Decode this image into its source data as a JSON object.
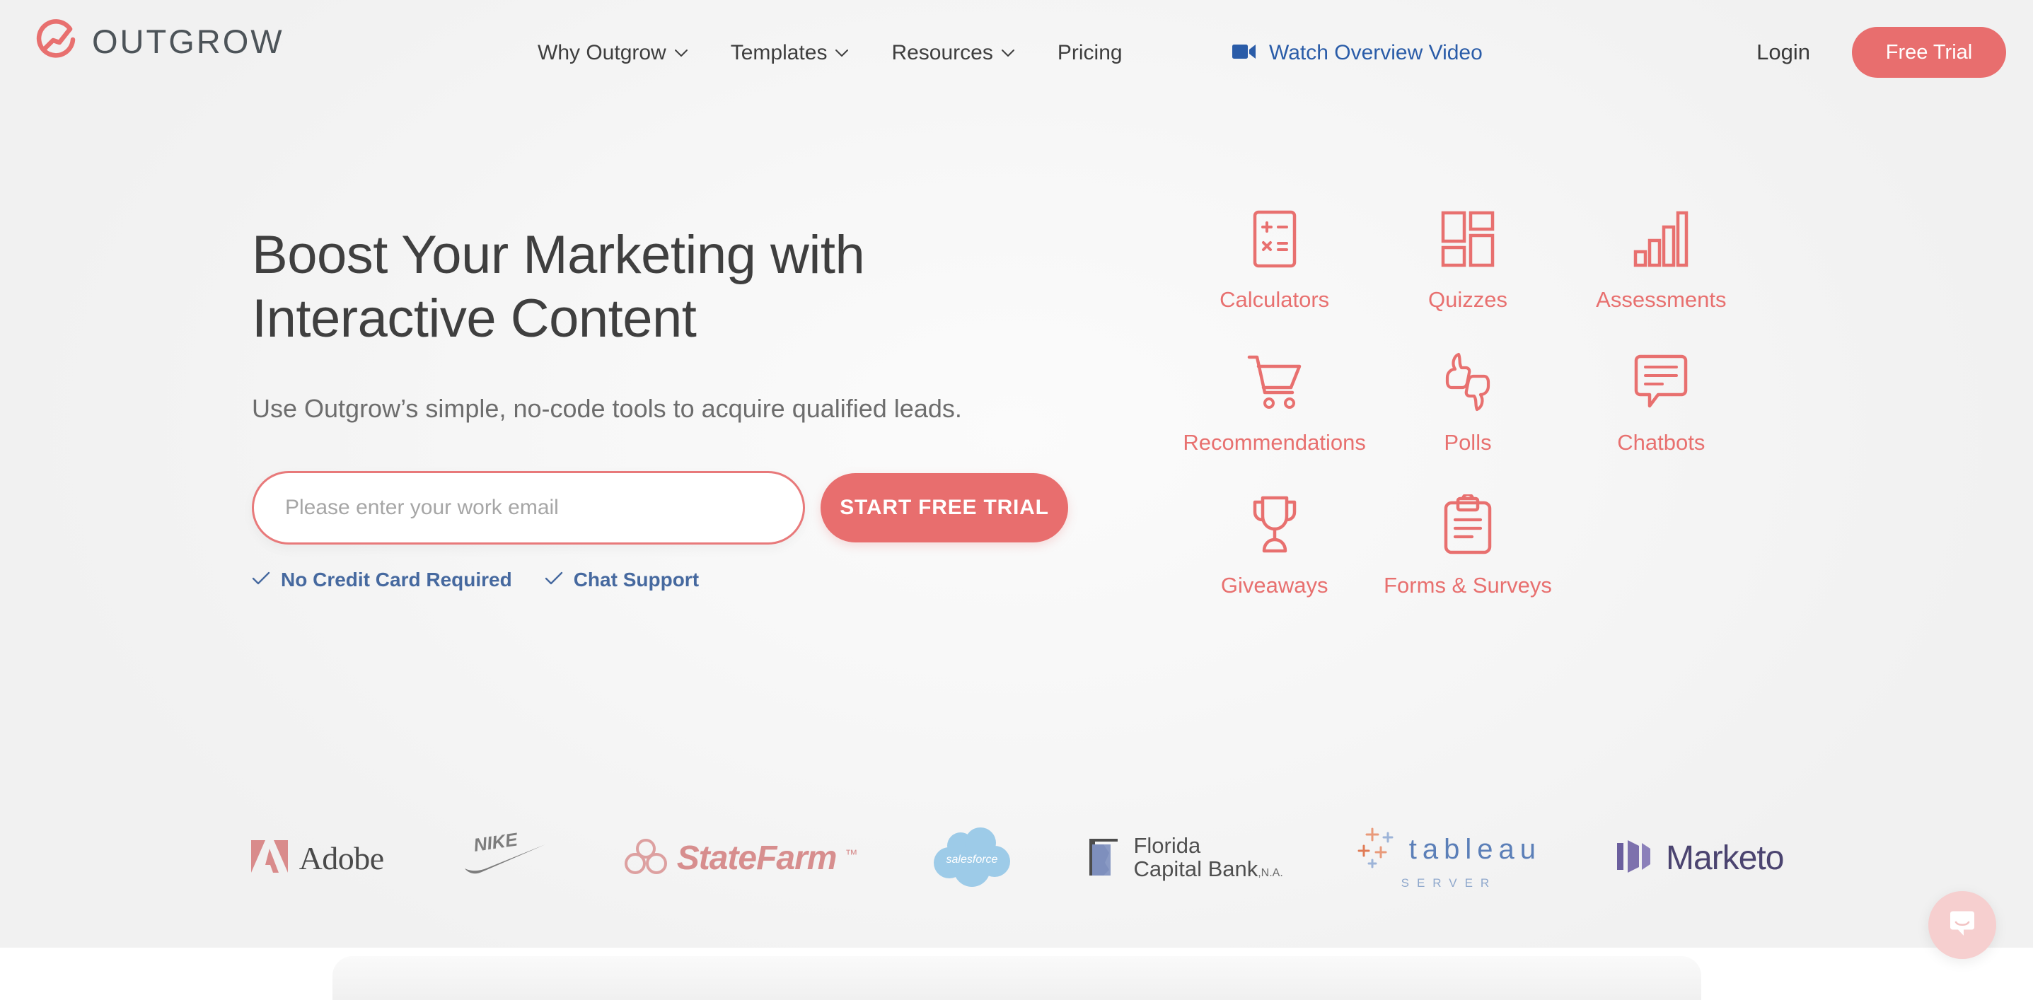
{
  "brand": {
    "name": "OUTGROW",
    "logo_icon": "outgrow-circle-logo",
    "accent_color": "#e86e6e",
    "accent_light": "#e8797a",
    "link_blue": "#2a5ca8",
    "perk_blue": "#46699f",
    "heading_gray": "#3f3f3f"
  },
  "header": {
    "nav": [
      {
        "label": "Why Outgrow",
        "icon": "chevron-down-icon",
        "has_dropdown": true
      },
      {
        "label": "Templates",
        "icon": "chevron-down-icon",
        "has_dropdown": true
      },
      {
        "label": "Resources",
        "icon": "chevron-down-icon",
        "has_dropdown": true
      },
      {
        "label": "Pricing",
        "icon": "",
        "has_dropdown": false
      }
    ],
    "video_link": {
      "label": "Watch Overview Video",
      "icon": "video-camera-icon"
    },
    "login_label": "Login",
    "free_trial_label": "Free Trial"
  },
  "hero": {
    "headline_line1": "Boost Your Marketing with",
    "headline_line2": "Interactive Content",
    "subheadline": "Use Outgrow’s simple, no-code tools to acquire qualified leads.",
    "email_placeholder": "Please enter your work email",
    "email_value": "",
    "cta_label": "START FREE TRIAL",
    "perks": [
      {
        "icon": "check-icon",
        "label": "No Credit Card Required"
      },
      {
        "icon": "check-icon",
        "label": "Chat Support"
      }
    ]
  },
  "product_tiles": [
    {
      "label": "Calculators",
      "icon": "calculator-icon"
    },
    {
      "label": "Quizzes",
      "icon": "quiz-grid-icon"
    },
    {
      "label": "Assessments",
      "icon": "bar-chart-icon"
    },
    {
      "label": "Recommendations",
      "icon": "shopping-cart-icon"
    },
    {
      "label": "Polls",
      "icon": "thumbs-up-down-icon"
    },
    {
      "label": "Chatbots",
      "icon": "chat-bubble-icon"
    },
    {
      "label": "Giveaways",
      "icon": "trophy-icon"
    },
    {
      "label": "Forms & Surveys",
      "icon": "clipboard-icon"
    }
  ],
  "brands": [
    {
      "name": "Adobe",
      "word": "Adobe",
      "icon": "adobe-logo"
    },
    {
      "name": "Nike",
      "word": "",
      "icon": "nike-swoosh-logo"
    },
    {
      "name": "State Farm",
      "word": "StateFarm",
      "icon": "state-farm-logo",
      "tm": "™"
    },
    {
      "name": "salesforce",
      "word": "salesforce",
      "icon": "salesforce-cloud-logo"
    },
    {
      "name": "Florida Capital Bank",
      "word_line1": "Florida",
      "word_line2": "Capital Bank",
      "suffix": ",N.A.",
      "icon": "florida-capital-bank-logo"
    },
    {
      "name": "Tableau Server",
      "word": "tableau",
      "sub": "SERVER",
      "icon": "tableau-logo"
    },
    {
      "name": "Marketo",
      "word": "Marketo",
      "icon": "marketo-logo"
    }
  ],
  "chat_widget": {
    "icon": "chat-smile-icon",
    "aria_label": "Open chat"
  }
}
